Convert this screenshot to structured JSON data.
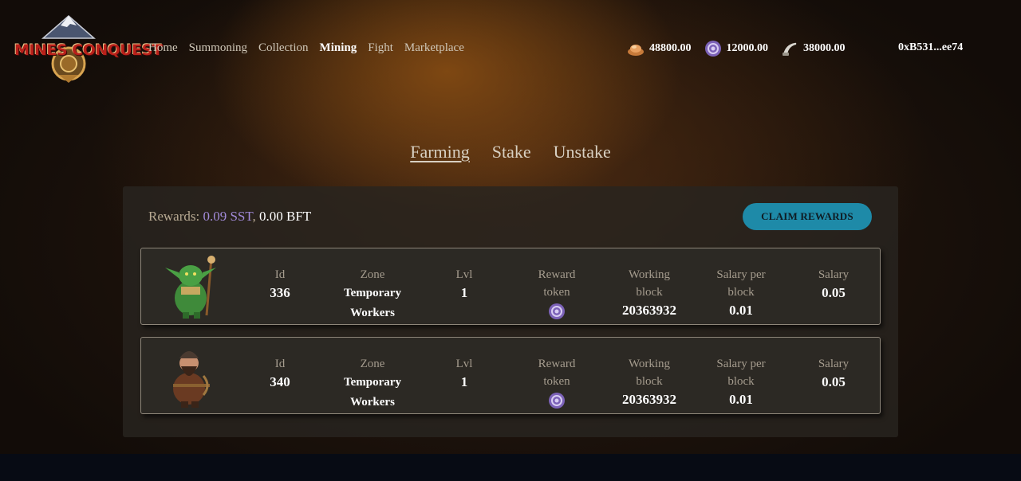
{
  "app": {
    "logo_text": "MINES CONQUEST"
  },
  "nav": {
    "items": [
      "Home",
      "Summoning",
      "Collection",
      "Mining",
      "Fight",
      "Marketplace"
    ],
    "active": "Mining"
  },
  "balances": [
    {
      "icon": "ore-pile-icon",
      "value": "48800.00"
    },
    {
      "icon": "purple-spiral-token-icon",
      "value": "12000.00"
    },
    {
      "icon": "horn-icon",
      "value": "38000.00"
    }
  ],
  "wallet": {
    "address": "0xB531...ee74"
  },
  "tabs": [
    "Farming",
    "Stake",
    "Unstake"
  ],
  "panel": {
    "rewards_label": "Rewards: ",
    "sst_amount": "0.09 SST",
    "separator": ", ",
    "bft_amount": "0.00 BFT",
    "claim_label": "CLAIM REWARDS"
  },
  "labels": {
    "id": "Id",
    "zone": "Zone",
    "lvl": "Lvl",
    "reward_token_1": "Reward",
    "reward_token_2": "token",
    "working_block_1": "Working",
    "working_block_2": "block",
    "salary_per_block_1": "Salary per",
    "salary_per_block_2": "block",
    "salary": "Salary"
  },
  "workers": [
    {
      "avatar": "goblin-shaman-icon",
      "id": "336",
      "zone_1": "Temporary",
      "zone_2": "Workers",
      "lvl": "1",
      "reward_token_icon": "purple-spiral-token-icon",
      "working_block": "20363932",
      "salary_per_block": "0.01",
      "salary": "0.05"
    },
    {
      "avatar": "dwarf-crossbowman-icon",
      "id": "340",
      "zone_1": "Temporary",
      "zone_2": "Workers",
      "lvl": "1",
      "reward_token_icon": "purple-spiral-token-icon",
      "working_block": "20363932",
      "salary_per_block": "0.01",
      "salary": "0.05"
    }
  ],
  "colors": {
    "accent_button": "#1e8aa8",
    "sst": "#a18ad8",
    "panel_bg": "#2c2924"
  }
}
